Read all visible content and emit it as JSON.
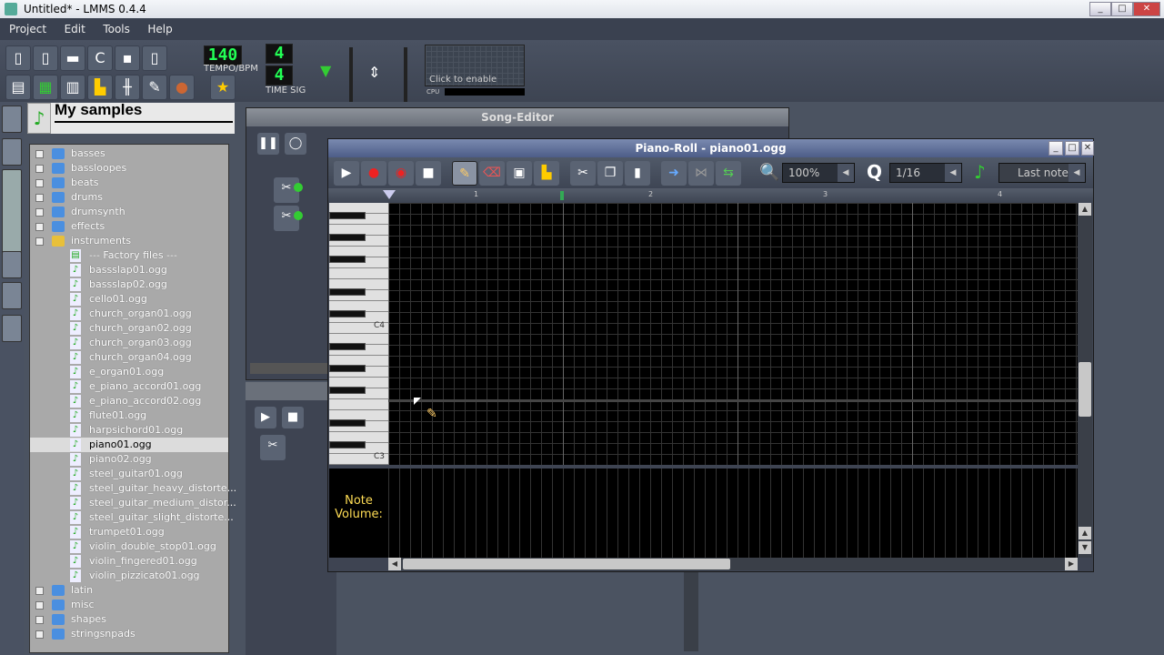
{
  "window": {
    "title": "Untitled* - LMMS 0.4.4"
  },
  "menu": [
    "Project",
    "Edit",
    "Tools",
    "Help"
  ],
  "toolbar": {
    "tempo": "140",
    "tempo_label": "TEMPO/BPM",
    "timesig_num": "4",
    "timesig_den": "4",
    "timesig_label": "TIME SIG",
    "graph_hint": "Click to enable",
    "cpu_label": "CPU"
  },
  "browser": {
    "title": "My samples",
    "items": [
      {
        "label": "basses",
        "type": "folder"
      },
      {
        "label": "bassloopes",
        "type": "folder"
      },
      {
        "label": "beats",
        "type": "folder"
      },
      {
        "label": "drums",
        "type": "folder"
      },
      {
        "label": "drumsynth",
        "type": "folder"
      },
      {
        "label": "effects",
        "type": "folder"
      },
      {
        "label": "instruments",
        "type": "folder-open"
      },
      {
        "label": "--- Factory files ---",
        "type": "sub"
      },
      {
        "label": "bassslap01.ogg",
        "type": "file"
      },
      {
        "label": "bassslap02.ogg",
        "type": "file"
      },
      {
        "label": "cello01.ogg",
        "type": "file"
      },
      {
        "label": "church_organ01.ogg",
        "type": "file"
      },
      {
        "label": "church_organ02.ogg",
        "type": "file"
      },
      {
        "label": "church_organ03.ogg",
        "type": "file"
      },
      {
        "label": "church_organ04.ogg",
        "type": "file"
      },
      {
        "label": "e_organ01.ogg",
        "type": "file"
      },
      {
        "label": "e_piano_accord01.ogg",
        "type": "file"
      },
      {
        "label": "e_piano_accord02.ogg",
        "type": "file"
      },
      {
        "label": "flute01.ogg",
        "type": "file"
      },
      {
        "label": "harpsichord01.ogg",
        "type": "file"
      },
      {
        "label": "piano01.ogg",
        "type": "file",
        "selected": true
      },
      {
        "label": "piano02.ogg",
        "type": "file"
      },
      {
        "label": "steel_guitar01.ogg",
        "type": "file"
      },
      {
        "label": "steel_guitar_heavy_distorte...",
        "type": "file"
      },
      {
        "label": "steel_guitar_medium_distor...",
        "type": "file"
      },
      {
        "label": "steel_guitar_slight_distorte...",
        "type": "file"
      },
      {
        "label": "trumpet01.ogg",
        "type": "file"
      },
      {
        "label": "violin_double_stop01.ogg",
        "type": "file"
      },
      {
        "label": "violin_fingered01.ogg",
        "type": "file"
      },
      {
        "label": "violin_pizzicato01.ogg",
        "type": "file"
      },
      {
        "label": "latin",
        "type": "folder"
      },
      {
        "label": "misc",
        "type": "folder"
      },
      {
        "label": "shapes",
        "type": "folder"
      },
      {
        "label": "stringsnpads",
        "type": "folder"
      }
    ]
  },
  "song_editor": {
    "title": "Song-Editor"
  },
  "piano_roll": {
    "title": "Piano-Roll - piano01.ogg",
    "zoom": "100%",
    "quantize_label": "Q",
    "quantize": "1/16",
    "note_length": "Last note",
    "ruler": [
      "1",
      "2",
      "3",
      "4"
    ],
    "key_labels": [
      "C4",
      "C3"
    ],
    "note_volume_label": "Note Volume:"
  }
}
